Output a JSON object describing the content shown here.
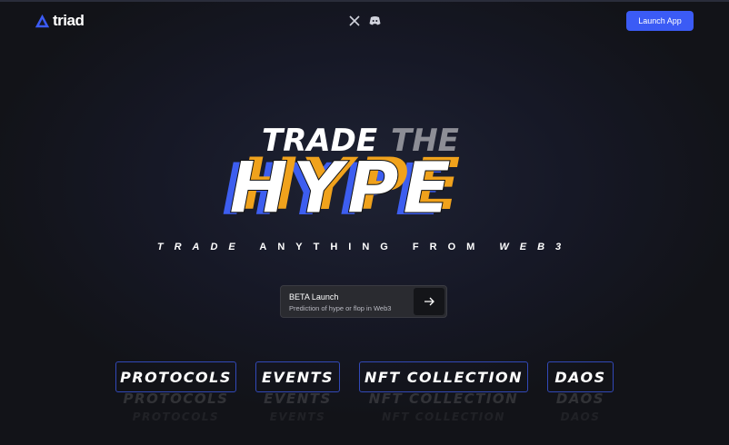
{
  "header": {
    "logo_text": "triad",
    "social": [
      {
        "icon": "x-icon"
      },
      {
        "icon": "discord-icon"
      }
    ],
    "launch_label": "Launch App"
  },
  "hero": {
    "line1_a": "TRADE",
    "line1_b": "THE",
    "line2": "HYPE",
    "tagline": {
      "word1": "TRADE",
      "word2": "ANYTHING",
      "word3": "FROM",
      "word4": "WEB3"
    }
  },
  "beta": {
    "title": "BETA Launch",
    "subtitle": "Prediction of hype or flop in Web3"
  },
  "categories": [
    {
      "label": "PROTOCOLS"
    },
    {
      "label": "EVENTS"
    },
    {
      "label": "NFT COLLECTION"
    },
    {
      "label": "DAOS"
    }
  ],
  "colors": {
    "accent": "#3b5bf5",
    "orange": "#f0a21c",
    "blue": "#3d5ef0"
  }
}
